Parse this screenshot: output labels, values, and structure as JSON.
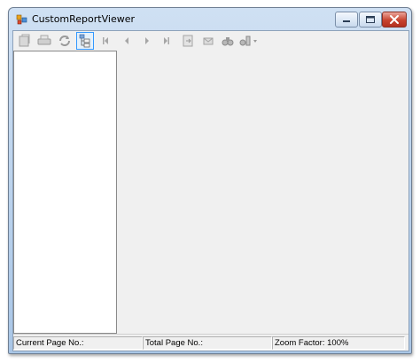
{
  "window": {
    "title": "CustomReportViewer"
  },
  "toolbar": {
    "buttons": [
      {
        "name": "open-icon",
        "enabled": false
      },
      {
        "name": "print-icon",
        "enabled": false
      },
      {
        "name": "refresh-icon",
        "enabled": false
      },
      {
        "name": "document-map-icon",
        "enabled": true,
        "pressed": true
      },
      {
        "name": "first-page-icon",
        "enabled": false
      },
      {
        "name": "previous-page-icon",
        "enabled": false
      },
      {
        "name": "next-page-icon",
        "enabled": false
      },
      {
        "name": "last-page-icon",
        "enabled": false
      },
      {
        "name": "export-icon",
        "enabled": false
      },
      {
        "name": "email-icon",
        "enabled": false
      },
      {
        "name": "find-icon",
        "enabled": false
      },
      {
        "name": "find-options-icon",
        "enabled": false
      }
    ]
  },
  "status": {
    "current_page": "Current Page No.:",
    "total_page": "Total Page No.:",
    "zoom": "Zoom Factor: 100%"
  },
  "colors": {
    "accent": "#3399ff",
    "close_button": "#c8432f",
    "titlebar": "#bcd3ec"
  }
}
